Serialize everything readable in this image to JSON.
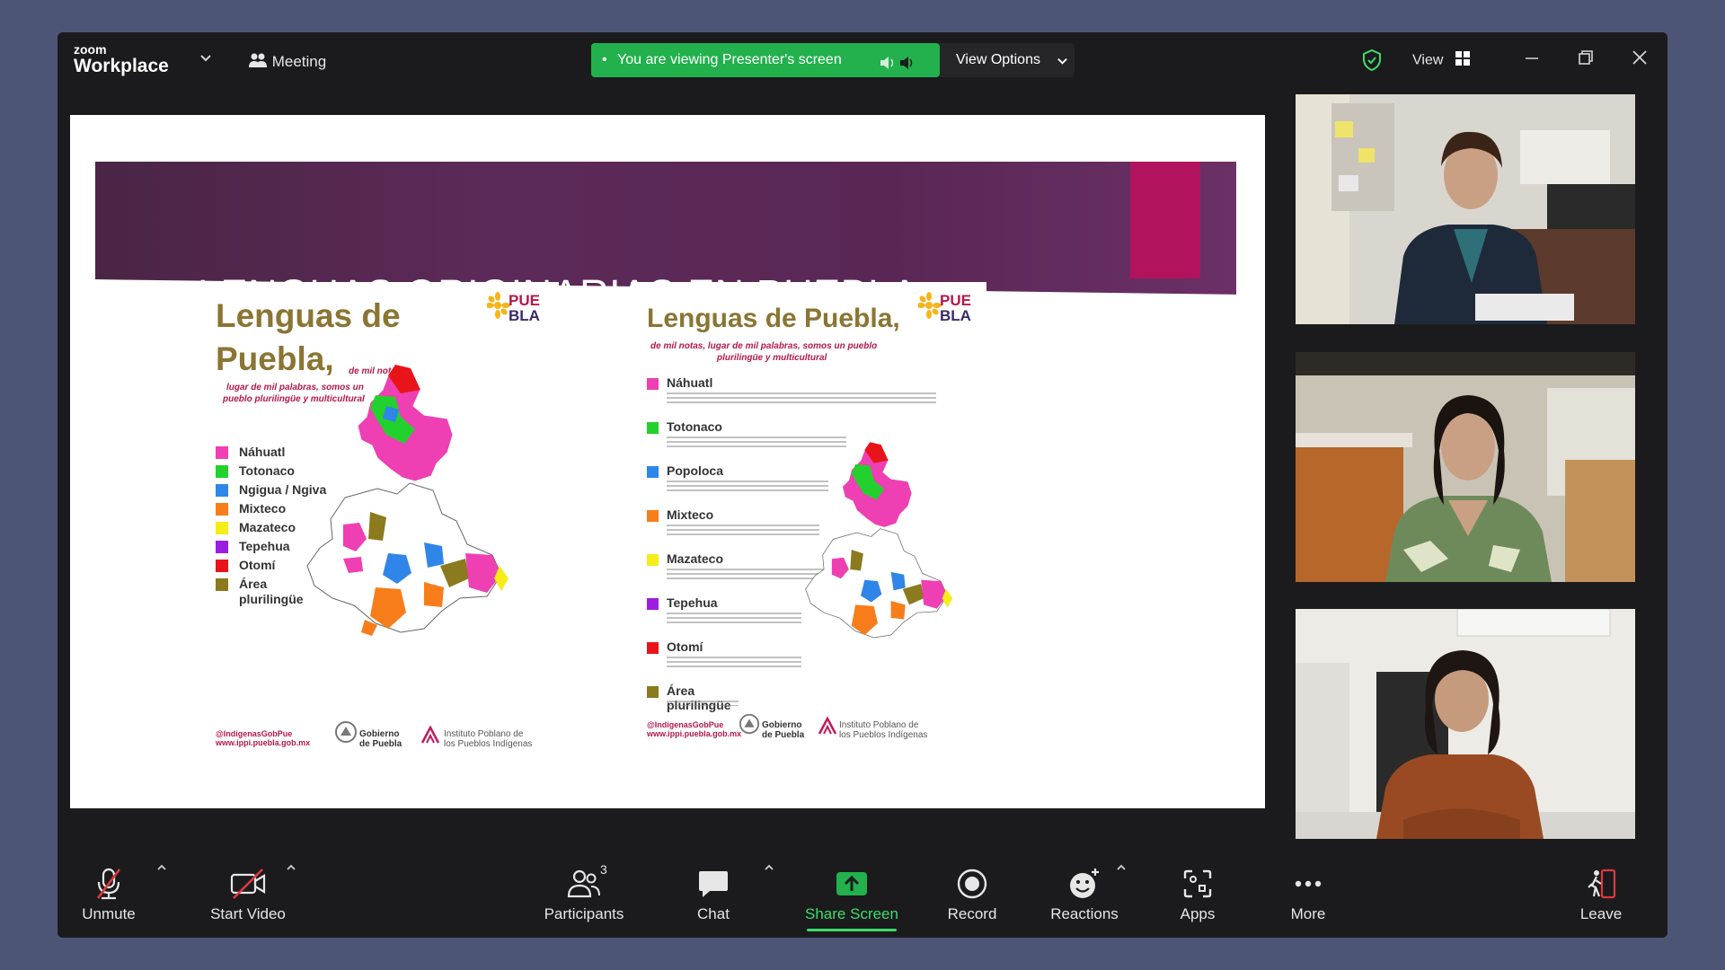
{
  "app": {
    "brand_small": "zoom",
    "brand_big": "Workplace",
    "meeting_label": "Meeting"
  },
  "banner": {
    "text": "You are viewing Presenter's screen",
    "view_options": "View Options"
  },
  "top_right": {
    "view_label": "View"
  },
  "slide": {
    "title": "LENGUAS ORIGINARIAS EN PUEBLA",
    "poster_left": {
      "title_line1": "Lenguas de",
      "title_line2": "Puebla,",
      "title_tail": "de mil notas",
      "subtitle_line1": "lugar de mil palabras, somos un",
      "subtitle_line2": "pueblo plurilingüe y multicultural",
      "logo_top": "PUE",
      "logo_bottom": "BLA",
      "legend": [
        {
          "label": "Náhuatl",
          "color": "#ee3fb3"
        },
        {
          "label": "Totonaco",
          "color": "#22d12d"
        },
        {
          "label": "Ngigua / Ngiva",
          "color": "#2f86e8"
        },
        {
          "label": "Mixteco",
          "color": "#f77d1b"
        },
        {
          "label": "Mazateco",
          "color": "#f6ec17"
        },
        {
          "label": "Tepehua",
          "color": "#9b1ee0"
        },
        {
          "label": "Otomí",
          "color": "#e8141a"
        },
        {
          "label": "Área",
          "color": "#8b7a1e"
        }
      ],
      "legend_last_line2": "plurilingüe",
      "footer_handle": "@IndigenasGobPue",
      "footer_site": "www.ippi.puebla.gob.mx",
      "footer_gov_line1": "Gobierno",
      "footer_gov_line2": "de Puebla",
      "footer_inst_line1": "Instituto Poblano de",
      "footer_inst_line2": "los Pueblos Indígenas"
    },
    "poster_right": {
      "title": "Lenguas de Puebla,",
      "subtitle_line1": "de mil notas, lugar de mil palabras, somos un pueblo",
      "subtitle_line2": "plurilingüe y multicultural",
      "logo_top": "PUE",
      "logo_bottom": "BLA",
      "legend": [
        {
          "label": "Náhuatl",
          "color": "#ee3fb3"
        },
        {
          "label": "Totonaco",
          "color": "#22d12d"
        },
        {
          "label": "Popoloca",
          "color": "#2f86e8"
        },
        {
          "label": "Mixteco",
          "color": "#f77d1b"
        },
        {
          "label": "Mazateco",
          "color": "#f6ec17"
        },
        {
          "label": "Tepehua",
          "color": "#9b1ee0"
        },
        {
          "label": "Otomí",
          "color": "#e8141a"
        },
        {
          "label": "Área plurilingüe",
          "color": "#8b7a1e"
        }
      ],
      "footer_handle": "@IndigenasGobPue",
      "footer_site": "www.ippi.puebla.gob.mx",
      "footer_gov_line1": "Gobierno",
      "footer_gov_line2": "de Puebla",
      "footer_inst_line1": "Instituto Poblano de",
      "footer_inst_line2": "los Pueblos Indígenas"
    }
  },
  "toolbar": {
    "unmute": "Unmute",
    "start_video": "Start Video",
    "participants": "Participants",
    "participants_count": "3",
    "chat": "Chat",
    "share_screen": "Share Screen",
    "record": "Record",
    "reactions": "Reactions",
    "apps": "Apps",
    "more": "More",
    "leave": "Leave"
  },
  "colors": {
    "share_green": "#22b14c",
    "toolbar_accent": "#3ddc6b",
    "slide_band": "#5c2a58",
    "slide_pink": "#b2135d"
  }
}
